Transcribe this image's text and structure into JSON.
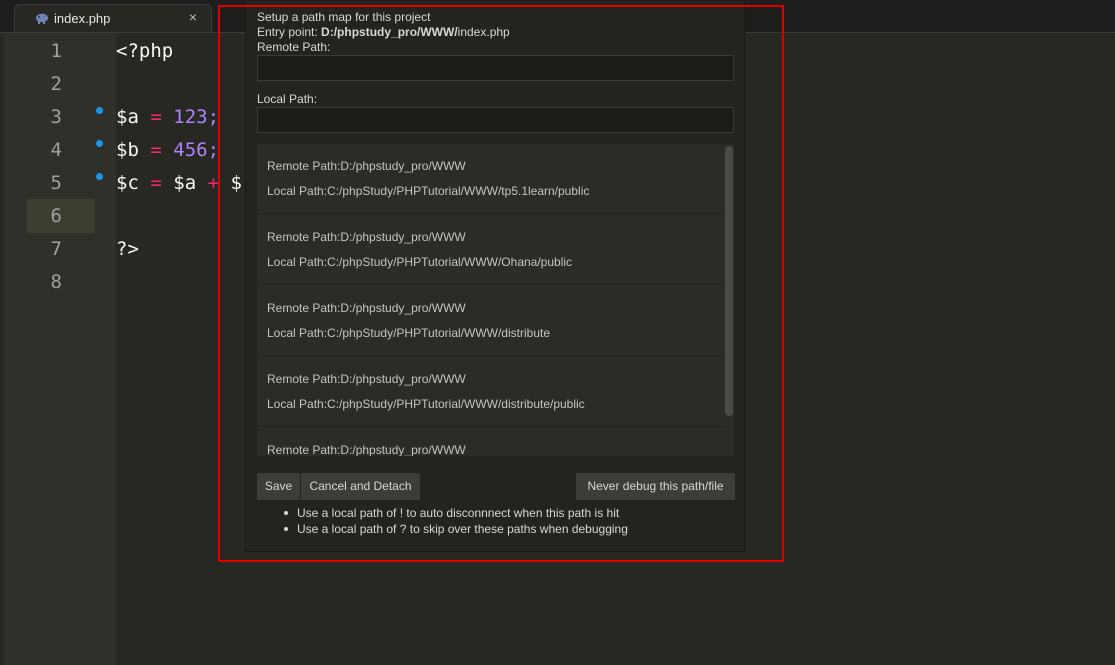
{
  "tab": {
    "label": "index.php",
    "close": "×",
    "icon": "php-elephant-icon"
  },
  "gutter": {
    "line_numbers": [
      "1",
      "2",
      "3",
      "4",
      "5",
      "6",
      "7",
      "8"
    ]
  },
  "code": {
    "l1": "<?php",
    "l3": {
      "var": "$a",
      "op": "=",
      "num": "123;"
    },
    "l4": {
      "var": "$b",
      "op": "=",
      "num": "456;"
    },
    "l5": {
      "var": "$c",
      "op": "=",
      "var2": "$a",
      "op2": "+",
      "var3": "$"
    },
    "l7": "?>"
  },
  "dialog": {
    "title": "Setup a path map for this project",
    "entry_prefix": "Entry point: ",
    "entry_bold": "D:/phpstudy_pro/WWW/",
    "entry_file": "index.php",
    "remote_label": "Remote Path:",
    "remote_value": "",
    "local_label": "Local Path:",
    "local_value": "",
    "mappings": [
      {
        "remote": "Remote Path:D:/phpstudy_pro/WWW",
        "local": "Local Path:C:/phpStudy/PHPTutorial/WWW/tp5.1learn/public"
      },
      {
        "remote": "Remote Path:D:/phpstudy_pro/WWW",
        "local": "Local Path:C:/phpStudy/PHPTutorial/WWW/Ohana/public"
      },
      {
        "remote": "Remote Path:D:/phpstudy_pro/WWW",
        "local": "Local Path:C:/phpStudy/PHPTutorial/WWW/distribute"
      },
      {
        "remote": "Remote Path:D:/phpstudy_pro/WWW",
        "local": "Local Path:C:/phpStudy/PHPTutorial/WWW/distribute/public"
      },
      {
        "remote": "Remote Path:D:/phpstudy_pro/WWW",
        "local": ""
      }
    ],
    "buttons": {
      "save": "Save",
      "cancel": "Cancel and Detach",
      "never": "Never debug this path/file"
    },
    "hints": [
      "Use a local path of ! to auto disconnnect when this path is hit",
      "Use a local path of ? to skip over these paths when debugging"
    ]
  },
  "colors": {
    "highlight_border": "#e00000",
    "breakpoint": "#1f95ea",
    "keyword": "#f92672",
    "number": "#ae81ff"
  }
}
